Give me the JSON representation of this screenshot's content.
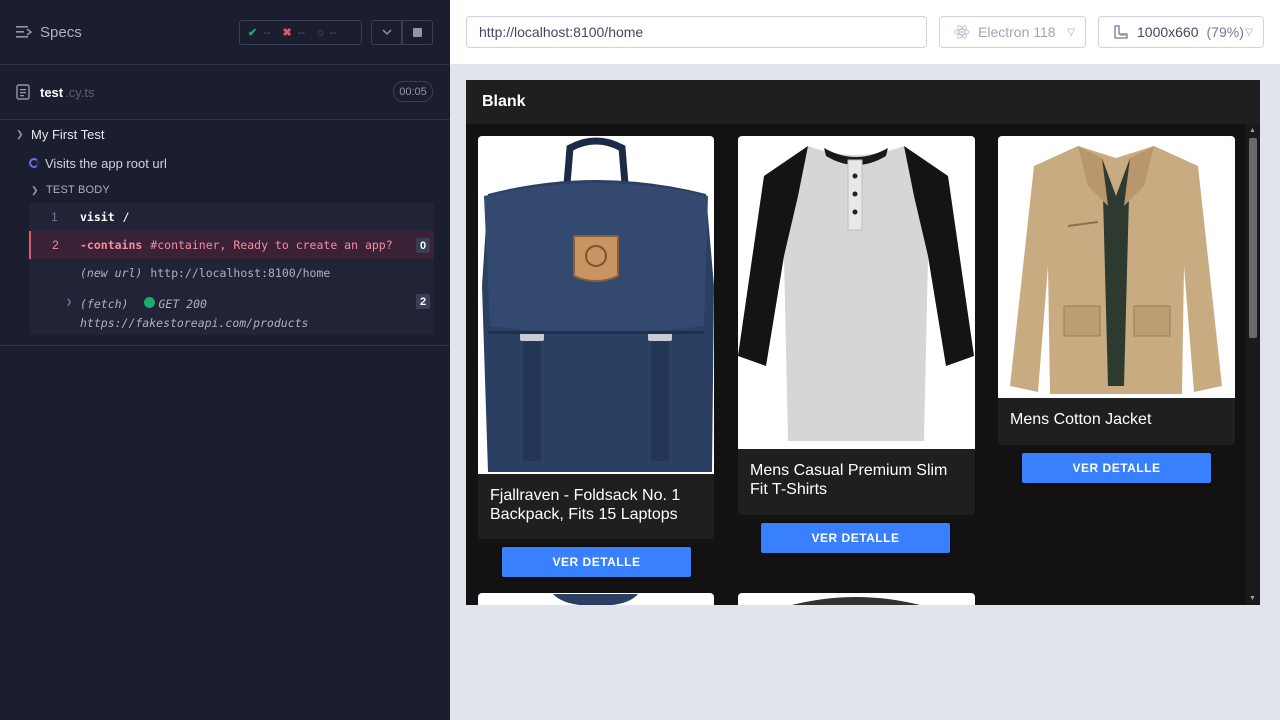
{
  "reporter": {
    "specs_label": "Specs",
    "stats": {
      "passed": "--",
      "failed": "--",
      "pending": "--"
    },
    "file": {
      "name": "test",
      "ext": ".cy.ts",
      "duration": "00:05"
    },
    "suite_title": "My First Test",
    "test_title": "Visits the app root url",
    "body_title": "TEST BODY",
    "commands": [
      {
        "num": "1",
        "name": "visit",
        "message": "/"
      },
      {
        "num": "2",
        "name": "-contains",
        "message": "#container, Ready to create an app?",
        "badge": "0"
      },
      {
        "name": "(new url)",
        "message": "http://localhost:8100/home"
      },
      {
        "name": "(fetch)",
        "method": "GET 200",
        "url": "https://fakestoreapi.com/products",
        "badge": "2"
      }
    ]
  },
  "topbar": {
    "url": "http://localhost:8100/home",
    "browser": "Electron 118",
    "viewport": "1000x660",
    "zoom": "(79%)"
  },
  "app": {
    "header_title": "Blank",
    "products": [
      {
        "title": "Fjallraven - Foldsack No. 1 Backpack, Fits 15 Laptops",
        "button": "VER DETALLE"
      },
      {
        "title": "Mens Casual Premium Slim Fit T-Shirts",
        "button": "VER DETALLE"
      },
      {
        "title": "Mens Cotton Jacket",
        "button": "VER DETALLE"
      }
    ]
  },
  "colors": {
    "accent": "#3880ff",
    "pass": "#1fa971",
    "fail": "#e45770",
    "panel": "#1b1e2e"
  }
}
